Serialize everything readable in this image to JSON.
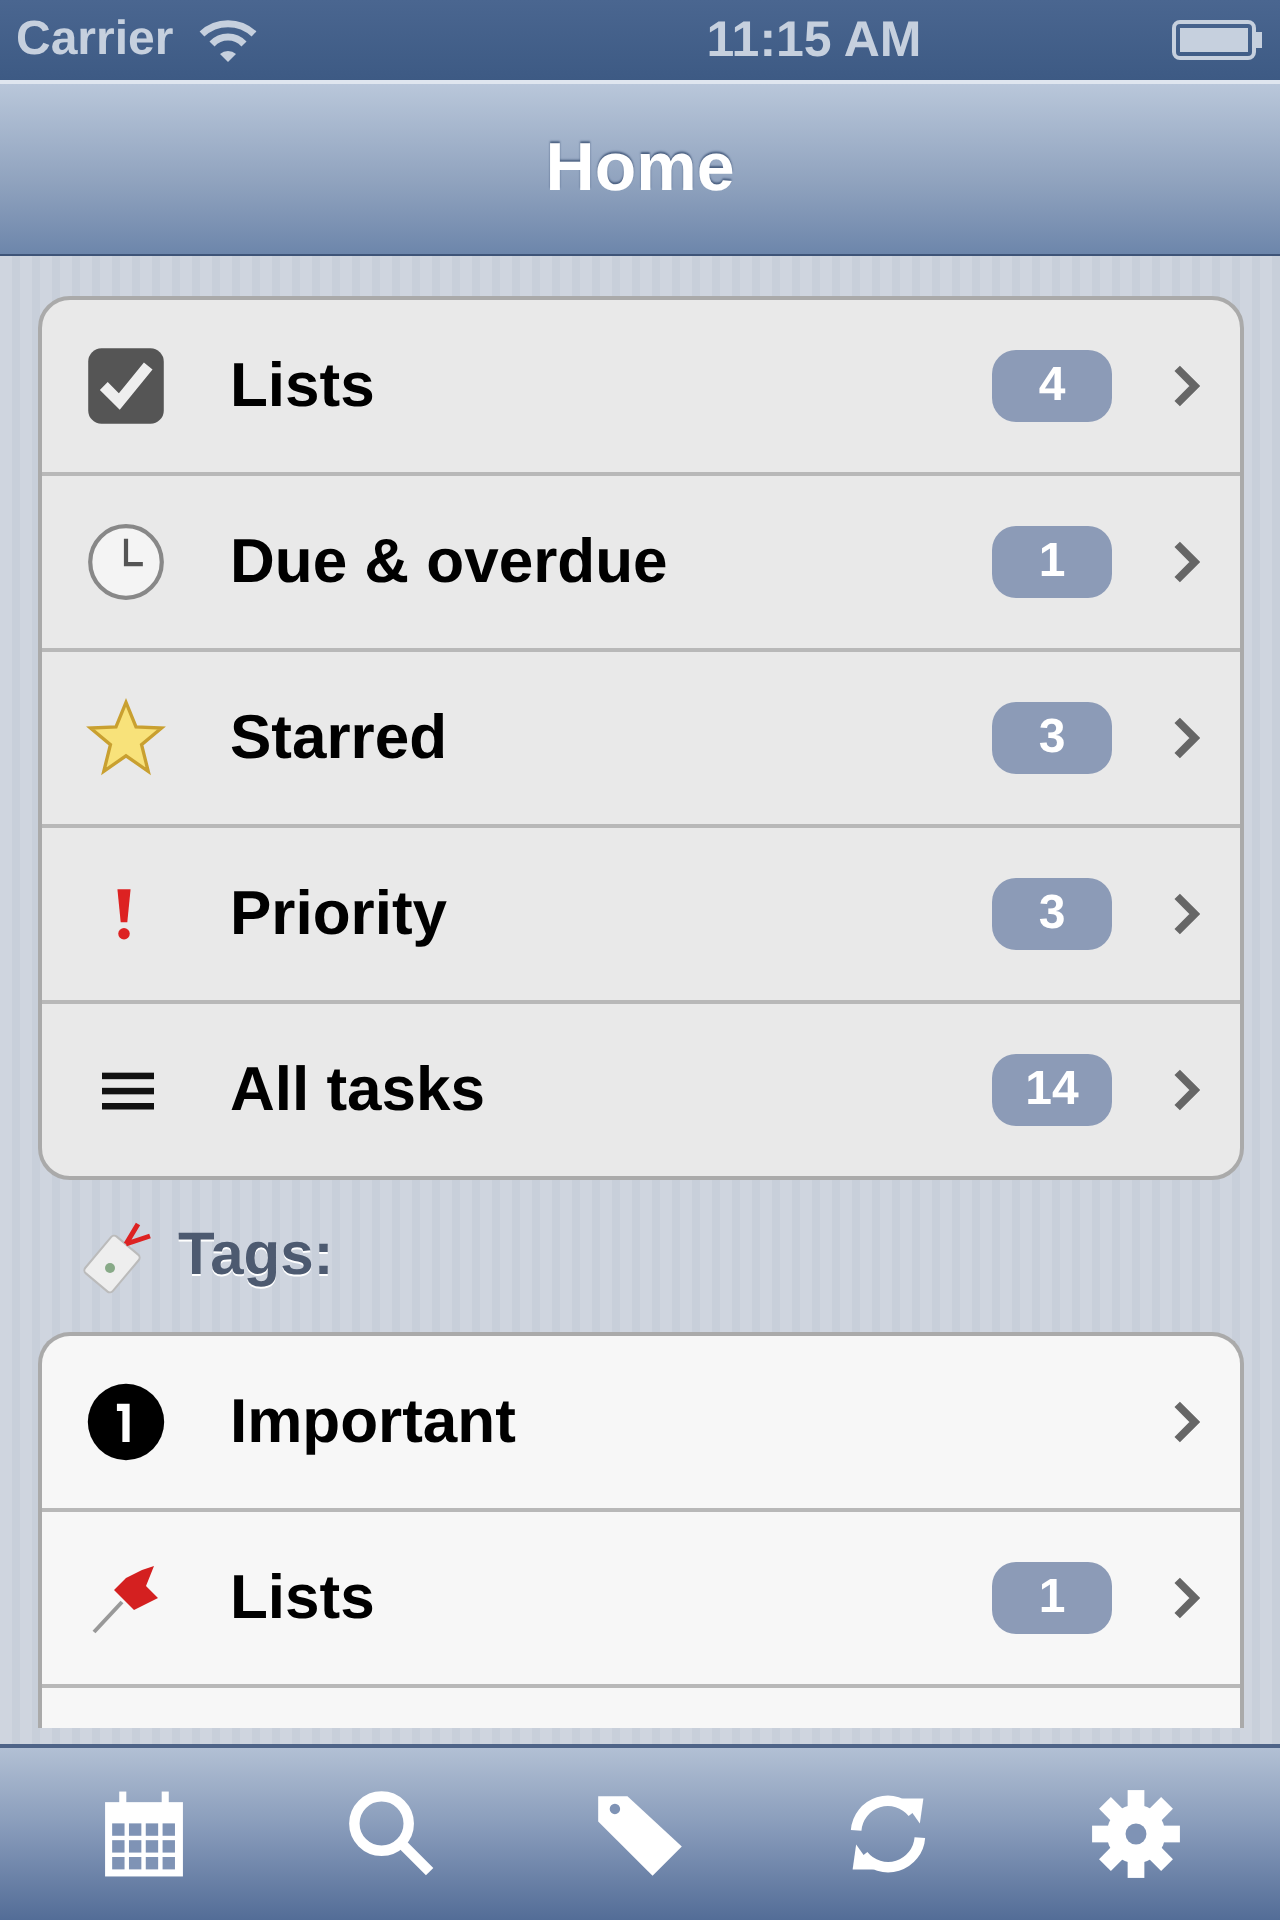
{
  "status_bar": {
    "carrier": "Carrier",
    "time": "11:15 AM"
  },
  "nav_bar": {
    "title": "Home"
  },
  "main_list": [
    {
      "kind": "checkbox",
      "label": "Lists",
      "count": "4"
    },
    {
      "kind": "clock",
      "label": "Due & overdue",
      "count": "1"
    },
    {
      "kind": "star",
      "label": "Starred",
      "count": "3"
    },
    {
      "kind": "priority",
      "label": "Priority",
      "count": "3"
    },
    {
      "kind": "lines",
      "label": "All tasks",
      "count": "14"
    }
  ],
  "tags_header": "Tags:",
  "tags": [
    {
      "kind": "number-one",
      "label": "Important"
    },
    {
      "kind": "pin",
      "label": "Lists",
      "count": "1"
    }
  ],
  "toolbar": [
    {
      "kind": "calendar"
    },
    {
      "kind": "search"
    },
    {
      "kind": "tag"
    },
    {
      "kind": "sync"
    },
    {
      "kind": "settings"
    }
  ]
}
